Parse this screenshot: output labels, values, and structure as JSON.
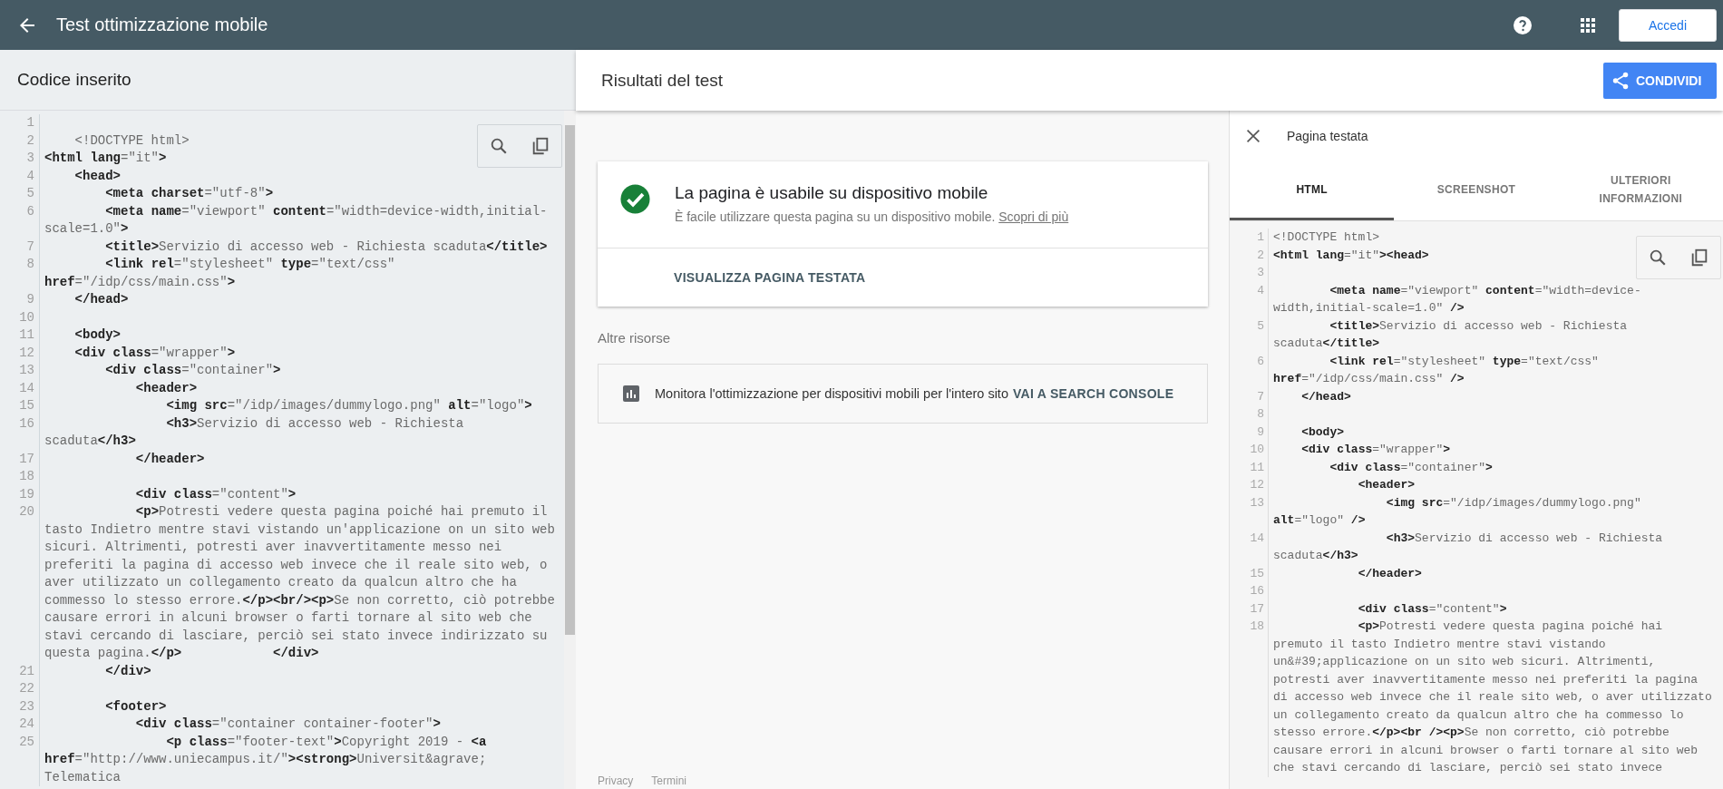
{
  "app_bar": {
    "title": "Test ottimizzazione mobile",
    "login_button": "Accedi"
  },
  "input_panel": {
    "title": "Codice inserito",
    "lines": [
      {
        "n": "1"
      },
      {
        "n": "2",
        "code": "    <!DOCTYPE html>"
      },
      {
        "n": "3",
        "code": "**<html lang**=\"it\"**>**"
      },
      {
        "n": "4",
        "code": "    **<head>**"
      },
      {
        "n": "5",
        "code": "        **<meta charset**=\"utf-8\"**>**"
      },
      {
        "n": "6",
        "code": "        **<meta name**=\"viewport\" **content**=\"width=device-width,initial-scale=1.0\"**>**"
      },
      {
        "n": "7",
        "code": "        **<title>**Servizio di accesso web - Richiesta scaduta**</title>**"
      },
      {
        "n": "8",
        "code": "        **<link rel**=\"stylesheet\" **type**=\"text/css\" **href**=\"/idp/css/main.css\"**>**"
      },
      {
        "n": "9",
        "code": "    **</head>**"
      },
      {
        "n": "10"
      },
      {
        "n": "11",
        "code": "    **<body>**"
      },
      {
        "n": "12",
        "code": "    **<div class**=\"wrapper\"**>**"
      },
      {
        "n": "13",
        "code": "        **<div class**=\"container\"**>**"
      },
      {
        "n": "14",
        "code": "            **<header>**"
      },
      {
        "n": "15",
        "code": "                **<img src**=\"/idp/images/dummylogo.png\" **alt**=\"logo\"**>**"
      },
      {
        "n": "16",
        "code": "                **<h3>**Servizio di accesso web - Richiesta scaduta**</h3>**"
      },
      {
        "n": "17",
        "code": "            **</header>**"
      },
      {
        "n": "18"
      },
      {
        "n": "19",
        "code": "            **<div class**=\"content\"**>**"
      },
      {
        "n": "20",
        "code": "            **<p>**Potresti vedere questa pagina poiché hai premuto il tasto Indietro mentre stavi vistando un'applicazione on un sito web sicuri. Altrimenti, potresti aver inavvertitamente messo nei preferiti la pagina di accesso web invece che il reale sito web, o aver utilizzato un collegamento creato da qualcun altro che ha commesso lo stesso errore.**</p><br/><p>**Se non corretto, ciò potrebbe causare errori in alcuni browser o farti tornare al sito web che stavi cercando di lasciare, perciò sei stato invece indirizzato su questa pagina.**</p>**            **</div>**"
      },
      {
        "n": "21",
        "code": "        **</div>**"
      },
      {
        "n": "22"
      },
      {
        "n": "23",
        "code": "        **<footer>**"
      },
      {
        "n": "24",
        "code": "            **<div class**=\"container container-footer\"**>**"
      },
      {
        "n": "25",
        "code": "                **<p class**=\"footer-text\"**>**Copyright 2019 - **<a href**=\"http://www.uniecampus.it/\"**><strong>**Universit&agrave; Telematica"
      }
    ]
  },
  "results": {
    "title": "Risultati del test",
    "share_button": "CONDIVIDI",
    "verdict": {
      "mobile_friendly": true,
      "title": "La pagina è usabile su dispositivo mobile",
      "description": "È facile utilizzare questa pagina su un dispositivo mobile.",
      "link": "Scopri di più",
      "action": "VISUALIZZA PAGINA TESTATA"
    },
    "resources_heading": "Altre risorse",
    "resources": [
      {
        "text": "Monitora l'ottimizzazione per dispositivi mobili per l'intero sito",
        "link": "VAI A SEARCH CONSOLE"
      }
    ],
    "footer_links": [
      "Privacy",
      "Termini"
    ]
  },
  "tested_page": {
    "title": "Pagina testata",
    "tabs": [
      {
        "label": "HTML",
        "selected": true
      },
      {
        "label": "SCREENSHOT",
        "selected": false
      },
      {
        "label": "ULTERIORI INFORMAZIONI",
        "selected": false
      }
    ],
    "lines": [
      {
        "n": "1",
        "code": "<!DOCTYPE html>"
      },
      {
        "n": "2",
        "code": "**<html lang**=\"it\"**><head>**"
      },
      {
        "n": "3"
      },
      {
        "n": "4",
        "code": "        **<meta name**=\"viewport\" **content**=\"width=device-width,initial-scale=1.0\" **/>**"
      },
      {
        "n": "5",
        "code": "        **<title>**Servizio di accesso web - Richiesta scaduta**</title>**"
      },
      {
        "n": "6",
        "code": "        **<link rel**=\"stylesheet\" **type**=\"text/css\" **href**=\"/idp/css/main.css\" **/>**"
      },
      {
        "n": "7",
        "code": "    **</head>**"
      },
      {
        "n": "8"
      },
      {
        "n": "9",
        "code": "    **<body>**"
      },
      {
        "n": "10",
        "code": "    **<div class**=\"wrapper\"**>**"
      },
      {
        "n": "11",
        "code": "        **<div class**=\"container\"**>**"
      },
      {
        "n": "12",
        "code": "            **<header>**"
      },
      {
        "n": "13",
        "code": "                **<img src**=\"/idp/images/dummylogo.png\" **alt**=\"logo\" **/>**"
      },
      {
        "n": "14",
        "code": "                **<h3>**Servizio di accesso web - Richiesta scaduta**</h3>**"
      },
      {
        "n": "15",
        "code": "            **</header>**"
      },
      {
        "n": "16"
      },
      {
        "n": "17",
        "code": "            **<div class**=\"content\"**>**"
      },
      {
        "n": "18",
        "code": "            **<p>**Potresti vedere questa pagina poiché hai premuto il tasto Indietro mentre stavi vistando un&#39;applicazione on un sito web sicuri. Altrimenti, potresti aver inavvertitamente messo nei preferiti la pagina di accesso web invece che il reale sito web, o aver utilizzato un collegamento creato da qualcun altro che ha commesso lo stesso errore.**</p><br /><p>**Se non corretto, ciò potrebbe causare errori in alcuni browser o farti tornare al sito web che stavi cercando di lasciare, perciò sei stato invece"
      }
    ]
  }
}
